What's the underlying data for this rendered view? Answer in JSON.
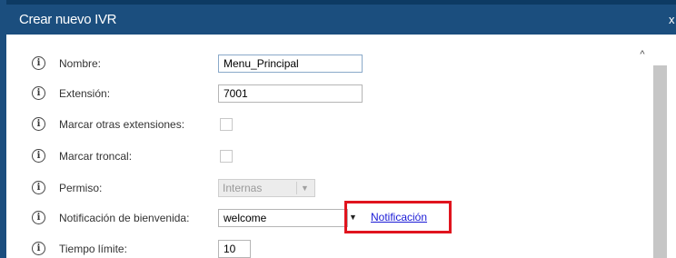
{
  "dialog": {
    "title": "Crear nuevo IVR",
    "close_label": "x"
  },
  "fields": {
    "nombre": {
      "label": "Nombre:",
      "value": "Menu_Principal"
    },
    "extension": {
      "label": "Extensión:",
      "value": "7001"
    },
    "marcar_extensiones": {
      "label": "Marcar otras extensiones:",
      "checked": false
    },
    "marcar_troncal": {
      "label": "Marcar troncal:",
      "checked": false
    },
    "permiso": {
      "label": "Permiso:",
      "selected": "Internas",
      "disabled": true
    },
    "notificacion": {
      "label": "Notificación de bienvenida:",
      "selected": "welcome",
      "link_label": "Notificación"
    },
    "tiempo_limite": {
      "label": "Tiempo límite:",
      "value": "10"
    }
  },
  "icons": {
    "info": "info-icon",
    "scroll_up": "chevron-up-icon",
    "dropdown": "triangle-down-icon"
  },
  "colors": {
    "titlebar": "#1b4e7e",
    "highlight": "#e0141e",
    "link": "#1a1ad6"
  }
}
